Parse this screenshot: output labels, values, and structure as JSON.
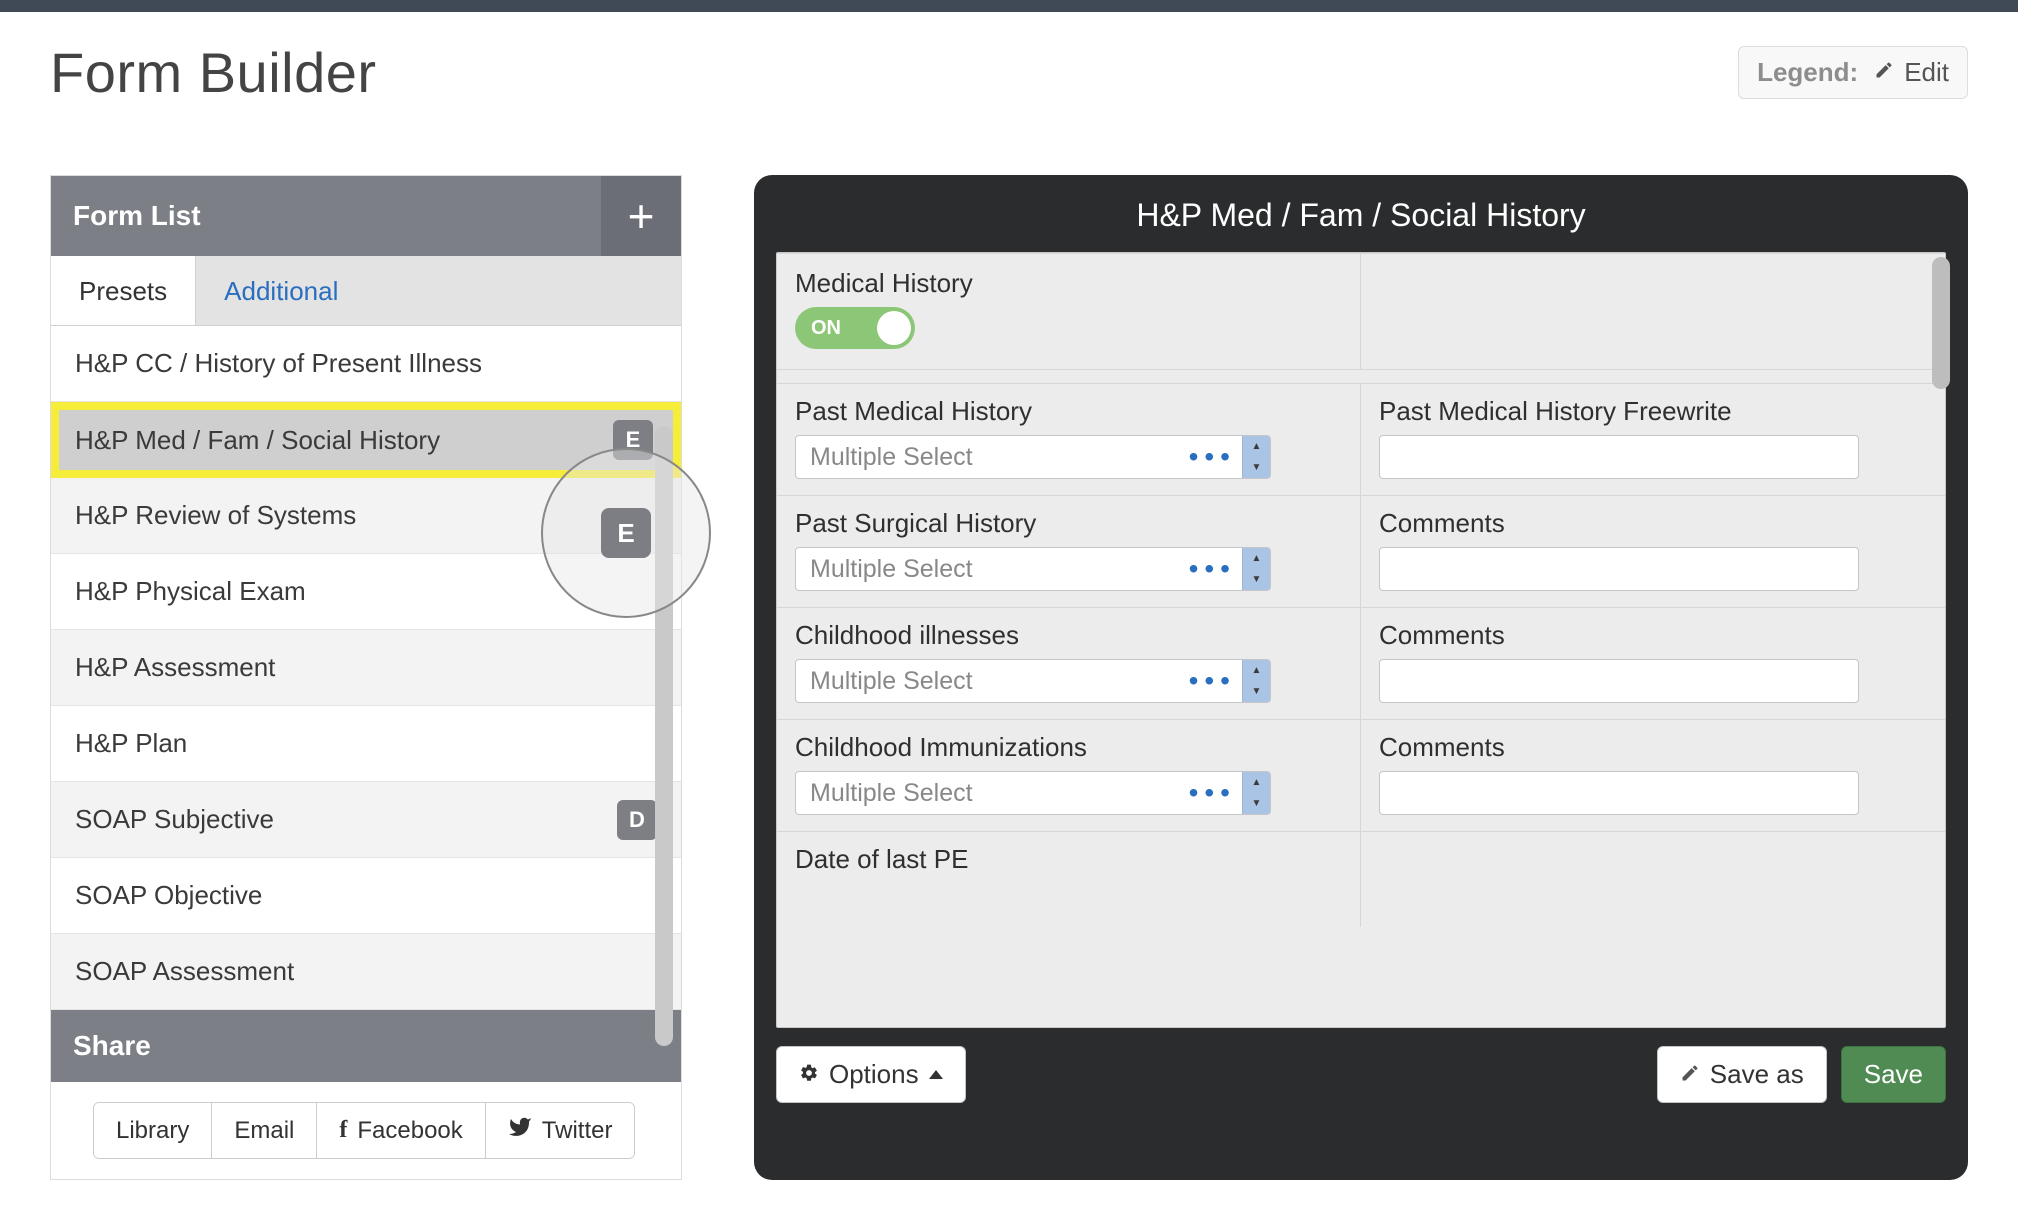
{
  "header": {
    "title": "Form Builder",
    "legend_label": "Legend:",
    "edit_label": "Edit"
  },
  "left": {
    "panel_title": "Form List",
    "tabs": {
      "presets": "Presets",
      "additional": "Additional"
    },
    "items": [
      {
        "label": "H&P CC / History of Present Illness",
        "badge": "",
        "alt": false,
        "selected": false
      },
      {
        "label": "H&P Med / Fam / Social History",
        "badge": "E",
        "alt": false,
        "selected": true
      },
      {
        "label": "H&P Review of Systems",
        "badge": "",
        "alt": true,
        "selected": false
      },
      {
        "label": "H&P Physical Exam",
        "badge": "",
        "alt": false,
        "selected": false
      },
      {
        "label": "H&P Assessment",
        "badge": "",
        "alt": true,
        "selected": false
      },
      {
        "label": "H&P Plan",
        "badge": "",
        "alt": false,
        "selected": false
      },
      {
        "label": "SOAP Subjective",
        "badge": "D",
        "alt": true,
        "selected": false
      },
      {
        "label": "SOAP Objective",
        "badge": "",
        "alt": false,
        "selected": false
      },
      {
        "label": "SOAP Assessment",
        "badge": "",
        "alt": true,
        "selected": false
      }
    ],
    "share_title": "Share",
    "share": {
      "library": "Library",
      "email": "Email",
      "facebook": "Facebook",
      "twitter": "Twitter"
    }
  },
  "right": {
    "title": "H&P Med / Fam / Social History",
    "toggle_section": {
      "label": "Medical History",
      "state": "ON"
    },
    "rows": [
      {
        "left_label": "Past Medical History",
        "left_placeholder": "Multiple Select",
        "right_label": "Past Medical History Freewrite"
      },
      {
        "left_label": "Past Surgical History",
        "left_placeholder": "Multiple Select",
        "right_label": "Comments"
      },
      {
        "left_label": "Childhood illnesses",
        "left_placeholder": "Multiple Select",
        "right_label": "Comments"
      },
      {
        "left_label": "Childhood Immunizations",
        "left_placeholder": "Multiple Select",
        "right_label": "Comments"
      }
    ],
    "last_row_label": "Date of last PE",
    "footer": {
      "options": "Options",
      "save_as": "Save as",
      "save": "Save"
    }
  }
}
